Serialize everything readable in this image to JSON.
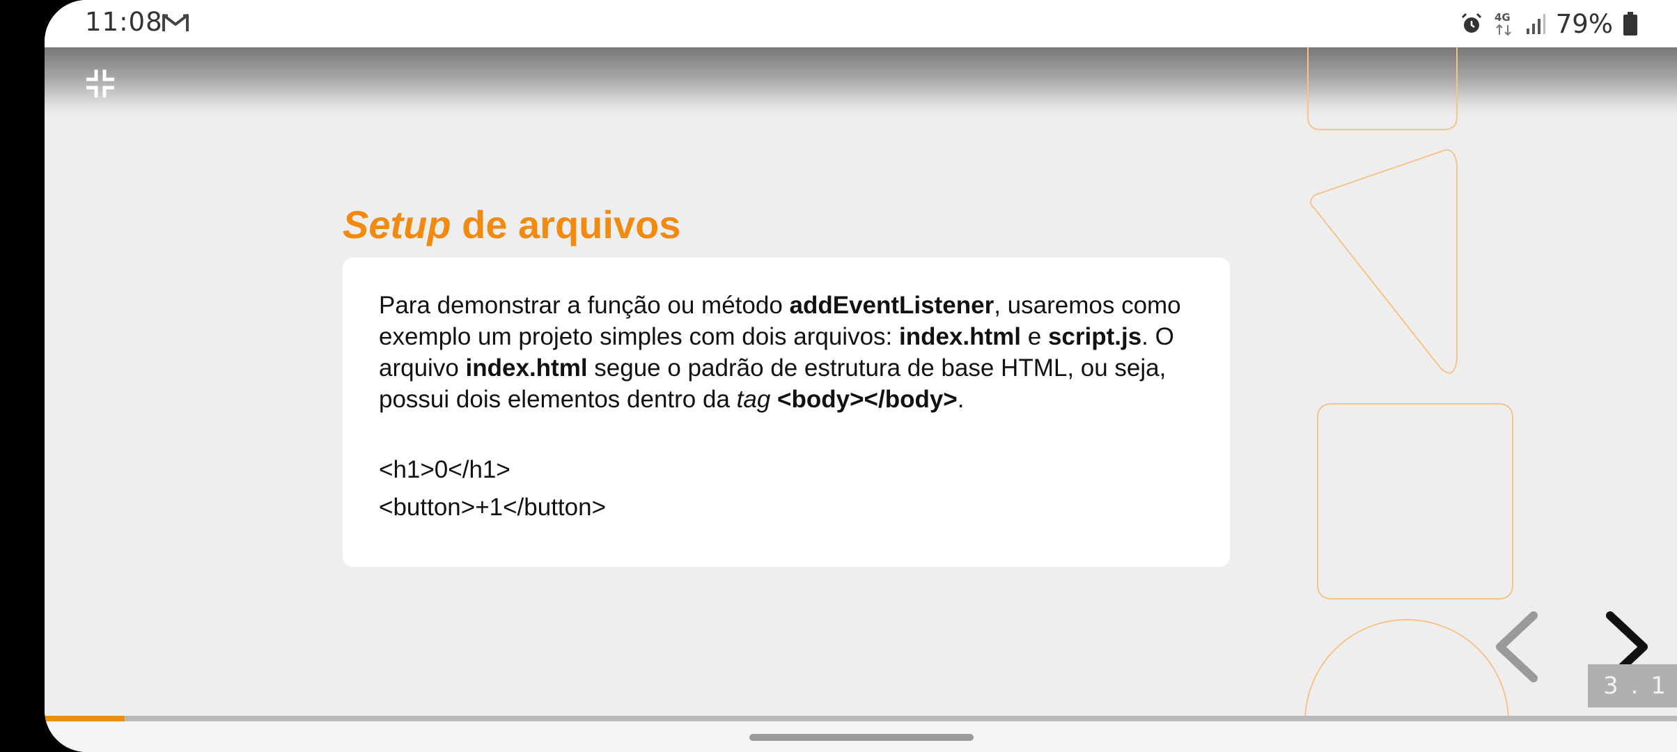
{
  "status_bar": {
    "time": "11:08",
    "network": "4G",
    "battery": "79%"
  },
  "slide": {
    "title_emphasis": "Setup",
    "title_rest": " de arquivos",
    "body": {
      "p1": "Para demonstrar a função ou método ",
      "b1": "addEventListener",
      "p2": ", usaremos como exemplo um projeto simples com dois arquivos: ",
      "b2": "index.html",
      "p3": " e ",
      "b3": "script.js",
      "p4": ". O arquivo ",
      "b4": "index.html",
      "p5": " segue o padrão de estrutura de base HTML, ou seja, possui dois elementos dentro da ",
      "i1": "tag",
      "p6": " ",
      "b5": "<body></body>",
      "p7": "."
    },
    "code_lines": [
      "<h1>0</h1>",
      "<button>+1</button>"
    ],
    "slide_number": "3.1",
    "progress": 0.049
  },
  "colors": {
    "accent": "#f08a10",
    "decoration": "#f6c48a",
    "slide_background": "#eeeeee"
  },
  "icons": {
    "exit_fullscreen": "exit-fullscreen-icon",
    "prev": "chevron-left-icon",
    "next": "chevron-right-icon",
    "mail": "gmail-icon",
    "alarm": "alarm-icon",
    "signal": "signal-icon",
    "battery": "battery-icon"
  }
}
